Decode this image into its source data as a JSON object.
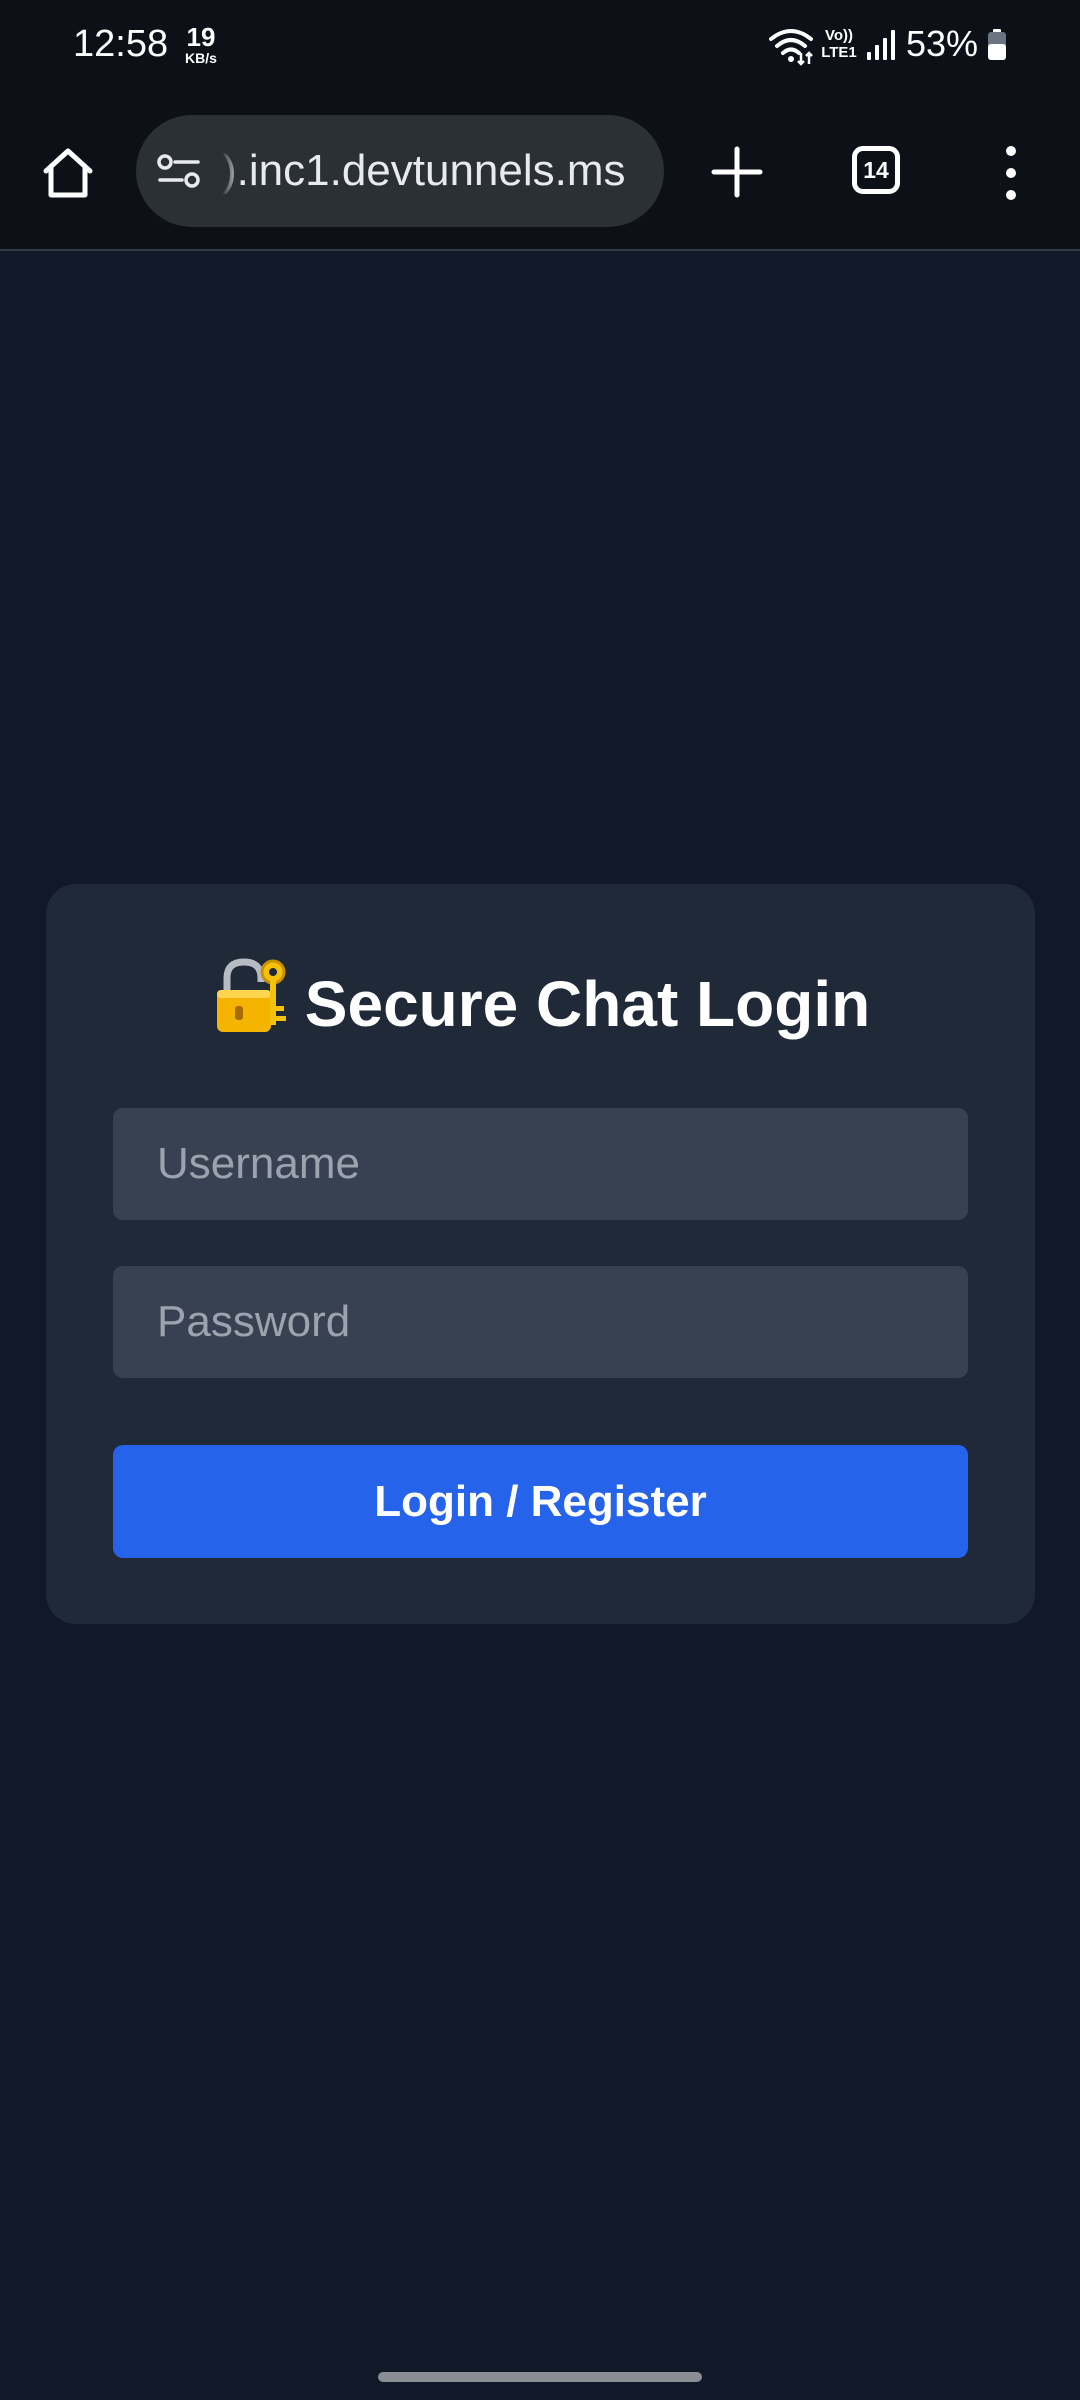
{
  "status_bar": {
    "time": "12:58",
    "net_speed_value": "19",
    "net_speed_unit": "KB/s",
    "volte_top": "Vo))",
    "volte_bottom": "LTE1",
    "battery_percent": "53%",
    "icons": [
      "wifi-icon",
      "signal-icon",
      "battery-icon"
    ]
  },
  "browser": {
    "url": ").inc1.devtunnels.ms",
    "tab_count": "14",
    "icons": [
      "home-icon",
      "site-settings-icon",
      "new-tab-icon",
      "tab-switcher-icon",
      "more-menu-icon"
    ]
  },
  "login": {
    "title": "Secure Chat Login",
    "title_emoji": "lock-with-key-icon",
    "username_placeholder": "Username",
    "password_placeholder": "Password",
    "submit_label": "Login / Register"
  },
  "colors": {
    "page_background": "#111827",
    "card_background": "#1f2937",
    "input_background": "#374151",
    "primary_button": "#2563eb",
    "browser_chrome": "#0d1117"
  }
}
